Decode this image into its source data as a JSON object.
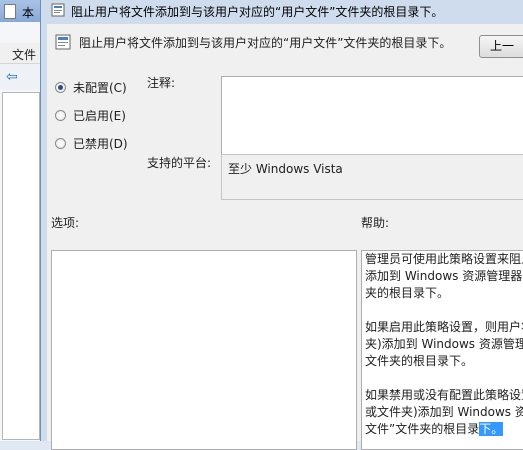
{
  "background_window": {
    "title_fragment": "本",
    "menu_fragment": "文件"
  },
  "dialog": {
    "title": "阻止用户将文件添加到与该用户对应的“用户文件”文件夹的根目录下。",
    "header_title": "阻止用户将文件添加到与该用户对应的“用户文件”文件夹的根目录下。",
    "prev_button": "上一",
    "radios": [
      {
        "label": "未配置(C)",
        "checked": true
      },
      {
        "label": "已启用(E)",
        "checked": false
      },
      {
        "label": "已禁用(D)",
        "checked": false
      }
    ],
    "comment_label": "注释:",
    "comment_value": "",
    "platform_label": "支持的平台:",
    "platform_value": "至少 Windows Vista",
    "options_label": "选项:",
    "help_label": "帮助:",
    "help_text": {
      "p1": [
        "管理员可使用此策略设置来阻止",
        "添加到 Windows 资源管理器中",
        "夹的根目录下。"
      ],
      "p2": [
        "如果启用此策略设置，则用户将",
        "夹)添加到 Windows 资源管理",
        "文件夹的根目录下。"
      ],
      "p3": [
        "如果禁用或没有配置此策略设置",
        "或文件夹)添加到 Windows 资",
        "文件”文件夹的根目录"
      ],
      "p3_selected_tail": "下。"
    }
  },
  "colors": {
    "title_bar": "#cfdcee",
    "client": "#f0f0f0",
    "selection": "#3399ff"
  }
}
